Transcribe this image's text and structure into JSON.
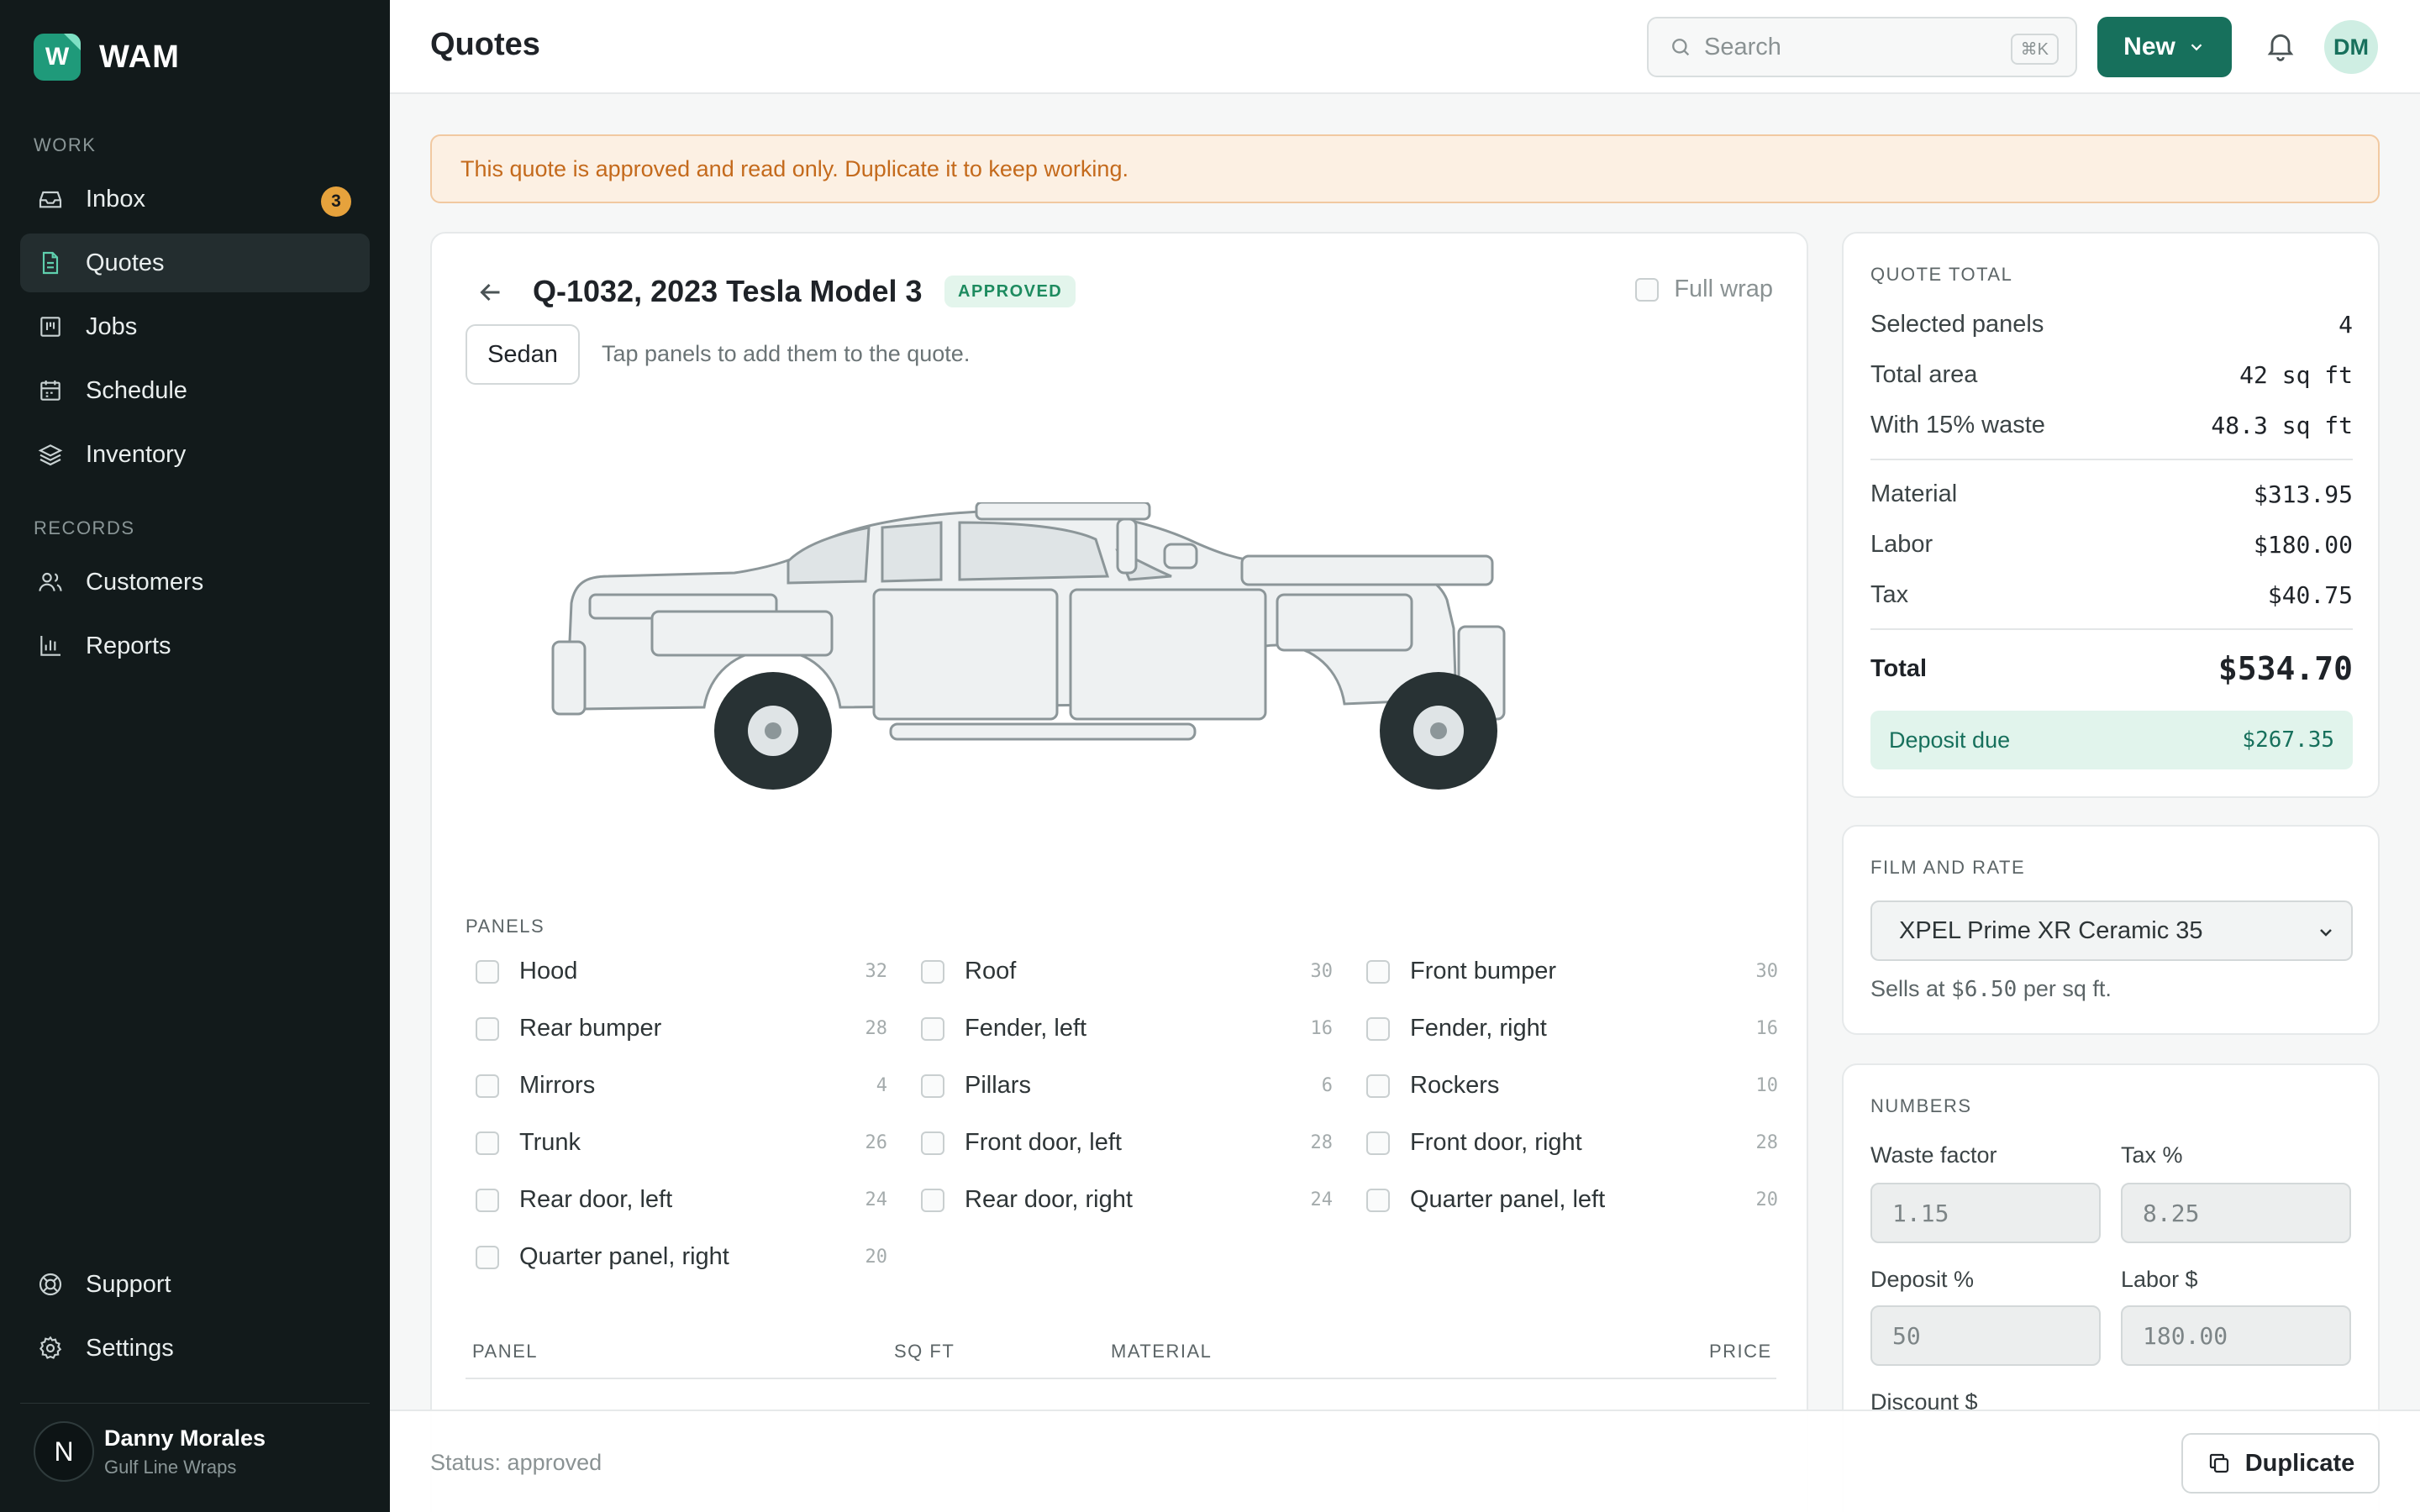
{
  "brand": {
    "name": "WAM",
    "logo_letter": "W"
  },
  "sidebar": {
    "work_label": "WORK",
    "records_label": "RECORDS",
    "items": [
      {
        "label": "Inbox",
        "icon": "inbox-icon",
        "badge": "3"
      },
      {
        "label": "Quotes",
        "icon": "document-icon",
        "active": true
      },
      {
        "label": "Jobs",
        "icon": "kanban-icon"
      },
      {
        "label": "Schedule",
        "icon": "calendar-icon"
      },
      {
        "label": "Inventory",
        "icon": "layers-icon"
      },
      {
        "label": "Customers",
        "icon": "users-icon"
      },
      {
        "label": "Reports",
        "icon": "bar-chart-icon"
      },
      {
        "label": "Support",
        "icon": "lifebuoy-icon"
      },
      {
        "label": "Settings",
        "icon": "gear-icon"
      }
    ],
    "user": {
      "initial": "N",
      "name": "Danny Morales",
      "org": "Gulf Line Wraps"
    }
  },
  "header": {
    "title": "Quotes",
    "search_placeholder": "Search",
    "search_shortcut": "⌘K",
    "new_label": "New",
    "avatar_initials": "DM"
  },
  "banner": {
    "text": "This quote is approved and read only. Duplicate it to keep working."
  },
  "quote": {
    "title": "Q-1032, 2023 Tesla Model 3",
    "status": "APPROVED",
    "full_wrap_label": "Full wrap",
    "body_style": "Sedan",
    "hint": "Tap panels to add them to the quote."
  },
  "panels": {
    "label": "PANELS",
    "items": [
      {
        "name": "Hood",
        "sqft": "32"
      },
      {
        "name": "Roof",
        "sqft": "30"
      },
      {
        "name": "Front bumper",
        "sqft": "30"
      },
      {
        "name": "Rear bumper",
        "sqft": "28"
      },
      {
        "name": "Fender, left",
        "sqft": "16"
      },
      {
        "name": "Fender, right",
        "sqft": "16"
      },
      {
        "name": "Mirrors",
        "sqft": "4"
      },
      {
        "name": "Pillars",
        "sqft": "6"
      },
      {
        "name": "Rockers",
        "sqft": "10"
      },
      {
        "name": "Trunk",
        "sqft": "26"
      },
      {
        "name": "Front door, left",
        "sqft": "28"
      },
      {
        "name": "Front door, right",
        "sqft": "28"
      },
      {
        "name": "Rear door, left",
        "sqft": "24"
      },
      {
        "name": "Rear door, right",
        "sqft": "24"
      },
      {
        "name": "Quarter panel, left",
        "sqft": "20"
      },
      {
        "name": "Quarter panel, right",
        "sqft": "20"
      }
    ]
  },
  "table": {
    "headers": [
      "PANEL",
      "SQ FT",
      "MATERIAL",
      "PRICE"
    ]
  },
  "totals": {
    "label": "QUOTE TOTAL",
    "selected_panels_label": "Selected panels",
    "selected_panels": "4",
    "total_area_label": "Total area",
    "total_area": "42 sq ft",
    "waste_label": "With 15% waste",
    "waste": "48.3 sq ft",
    "material_label": "Material",
    "material": "$313.95",
    "labor_label": "Labor",
    "labor": "$180.00",
    "tax_label": "Tax",
    "tax": "$40.75",
    "total_label": "Total",
    "total": "$534.70",
    "deposit_label": "Deposit due",
    "deposit": "$267.35"
  },
  "film": {
    "label": "FILM AND RATE",
    "selected": "XPEL Prime XR Ceramic 35",
    "sells_prefix": "Sells at",
    "sells_rate": "$6.50",
    "sells_suffix": "per sq ft."
  },
  "numbers": {
    "label": "NUMBERS",
    "waste_factor_label": "Waste factor",
    "waste_factor": "1.15",
    "tax_label": "Tax %",
    "tax": "8.25",
    "deposit_label": "Deposit %",
    "deposit": "50",
    "labor_label": "Labor $",
    "labor": "180.00",
    "discount_label": "Discount $"
  },
  "footer": {
    "status": "Status: approved",
    "duplicate_label": "Duplicate"
  },
  "colors": {
    "accent": "#17705c",
    "sidebar_bg": "#121a1b",
    "badge": "#e6a23c",
    "banner_text": "#c46a1c"
  }
}
